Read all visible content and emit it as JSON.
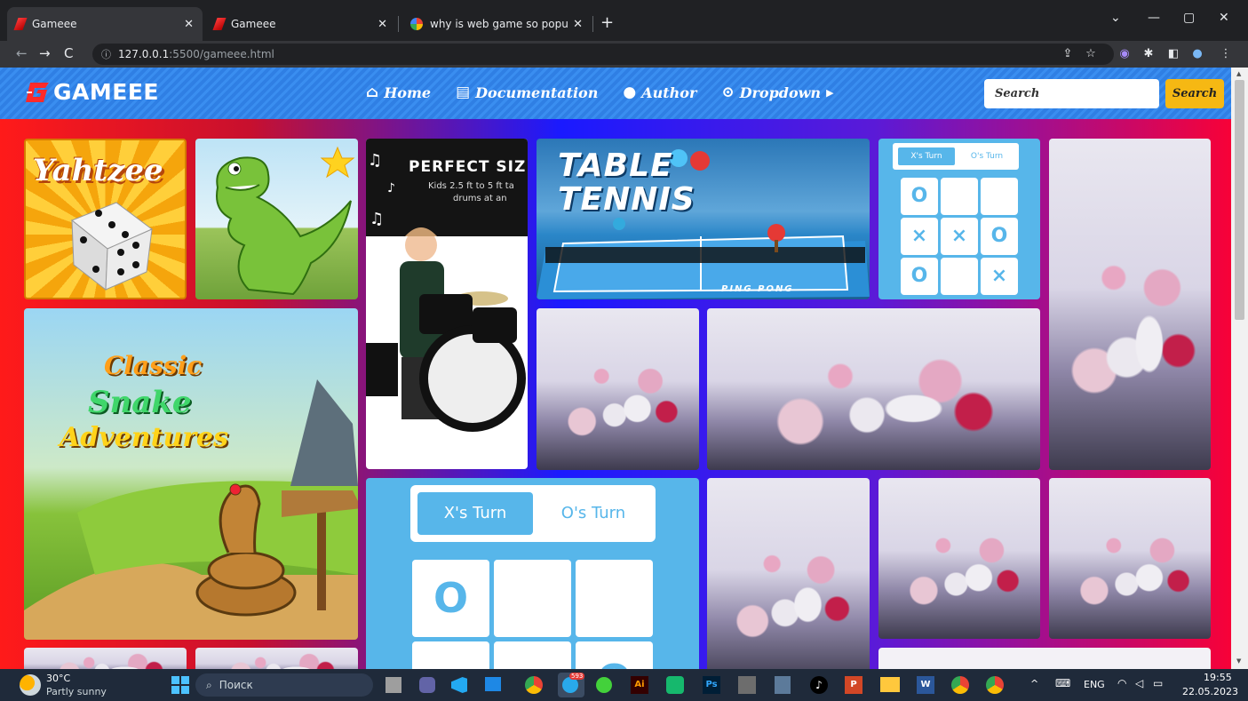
{
  "browser": {
    "tabs": [
      {
        "title": "Gameee",
        "active": true,
        "favicon": "gameee-icon"
      },
      {
        "title": "Gameee",
        "active": false,
        "favicon": "gameee-icon"
      },
      {
        "title": "why is web game so popular now",
        "active": false,
        "favicon": "google-icon"
      }
    ],
    "url_host": "127.0.0.1",
    "url_path": ":5500/gameee.html"
  },
  "site": {
    "logo_text": "GAMEEE",
    "nav": [
      {
        "label": "Home",
        "icon": "home-icon"
      },
      {
        "label": "Documentation",
        "icon": "document-icon"
      },
      {
        "label": "Author",
        "icon": "user-icon"
      },
      {
        "label": "Dropdown",
        "icon": "chevron-circle-icon"
      }
    ],
    "search": {
      "placeholder": "Search",
      "button_label": "Search"
    }
  },
  "tiles": {
    "yahtzee_title": "Yahtzee",
    "drums_title": "PERFECT SIZ",
    "drums_sub1": "Kids 2.5 ft to 5 ft ta",
    "drums_sub2": "drums at an",
    "tennis_line1": "TABLE",
    "tennis_line2": "TENNIS",
    "tennis_brand": "PING PONG",
    "snake_line1": "Classic",
    "snake_line2": "Snake",
    "snake_line3": "Adventures",
    "ttt_x_turn": "X's Turn",
    "ttt_o_turn": "O's Turn",
    "ttt_small_cells": [
      "O",
      "",
      "",
      "×",
      "×",
      "O",
      "O",
      "",
      "×"
    ],
    "ttt_big_cells": [
      "O",
      "",
      "",
      "×",
      "×",
      "O"
    ]
  },
  "taskbar": {
    "weather_temp": "30°C",
    "weather_desc": "Partly sunny",
    "search_placeholder": "Поиск",
    "lang": "ENG",
    "time": "19:55",
    "date": "22.05.2023",
    "telegram_badge": "593"
  }
}
